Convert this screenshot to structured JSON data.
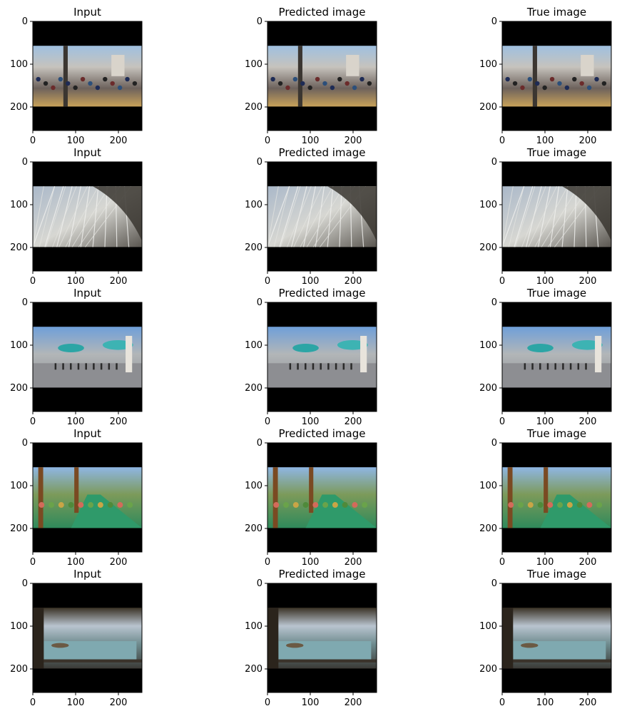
{
  "grid": {
    "rows": 5,
    "columns": [
      "Input",
      "Predicted image",
      "True image"
    ],
    "scenes": [
      "street-crowd",
      "ferris-wheel-structure",
      "plaza-with-umbrellas",
      "garden-path",
      "lake-view"
    ]
  },
  "axis": {
    "xlim": [
      0,
      255
    ],
    "ylim": [
      255,
      0
    ],
    "xticks": [
      0,
      100,
      200
    ],
    "yticks": [
      0,
      100,
      200
    ],
    "content_band": [
      57,
      199
    ]
  },
  "colors": {
    "background": "#ffffff",
    "letterbox": "#000000",
    "axis": "#000000"
  }
}
